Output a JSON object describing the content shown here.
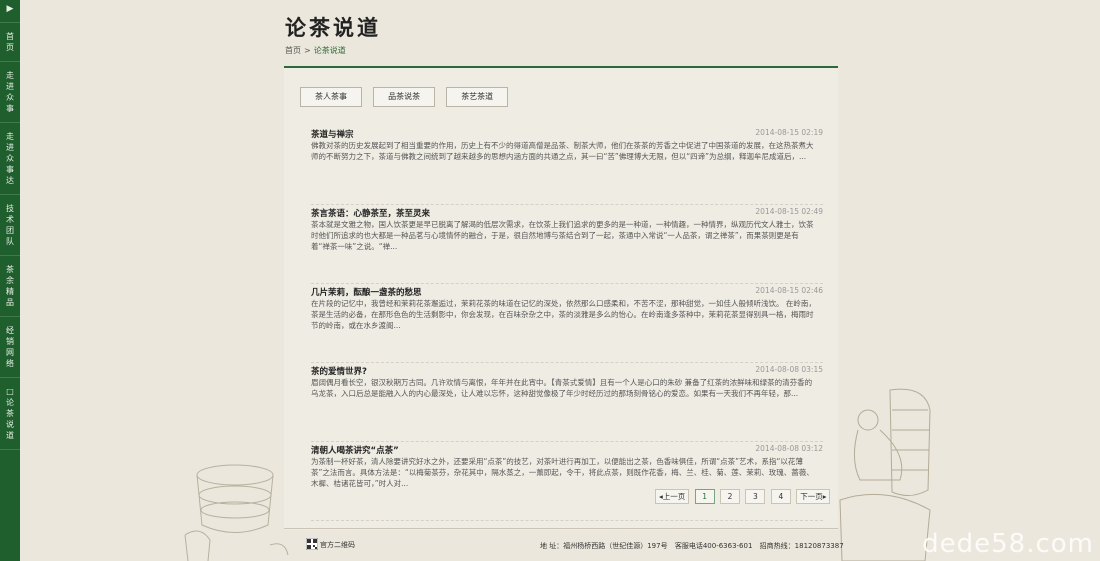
{
  "sidenav": {
    "arrow": "▶",
    "items": [
      {
        "label": "首页",
        "chars": [
          "首",
          "页"
        ]
      },
      {
        "label": "走进众事",
        "chars": [
          "走",
          "进",
          "众",
          "事"
        ]
      },
      {
        "label": "走进众事达",
        "chars": [
          "走",
          "进",
          "众",
          "事",
          "达"
        ]
      },
      {
        "label": "技术团队",
        "chars": [
          "技",
          "术",
          "团",
          "队"
        ]
      },
      {
        "label": "茶余精品",
        "chars": [
          "茶",
          "余",
          "精",
          "品"
        ]
      },
      {
        "label": "经销网络",
        "chars": [
          "经",
          "销",
          "网",
          "络"
        ]
      },
      {
        "label": "□论茶说道",
        "chars": [
          "□",
          "论",
          "茶",
          "说",
          "道"
        ]
      }
    ]
  },
  "header": {
    "title": "论茶说道",
    "breadcrumb": {
      "home": "首页",
      "sep": ">",
      "current": "论茶说道"
    }
  },
  "tabs": [
    "茶人茶事",
    "品茶说茶",
    "茶艺茶道"
  ],
  "articles": [
    {
      "title": "茶道与禅宗",
      "date": "2014-08-15 02:19",
      "excerpt": "佛教对茶的历史发展起到了相当重要的作用，历史上有不少的得道高僧是品茶、制茶大师，他们在茶茶的芳香之中促进了中国茶道的发展，在这热茶煮大师的不断努力之下，茶道与佛教之间统到了越来越多的思想内涵方面的共通之点，其一曰“苦”佛理博大无限，但以“四谛”为总纲，释迦牟尼成道后，..."
    },
    {
      "title": "茶言茶语：心静茶至，茶至灵来",
      "date": "2014-08-15 02:49",
      "excerpt": "茶本就是文雅之物，国人饮茶更是早已脱离了解渴的低层次需求，在饮茶上我们追求的更多的是一种道，一种情趣，一种情界，纵观历代文人雅士，饮茶时他们所追求的也大都是一种品茗与心境情怀的融合，于是，很自然地博与茶结合到了一起，茶通中入常说“一人品茶，谓之禅茶”，而果茶则更是有着“禅茶一味”之说。“禅..."
    },
    {
      "title": "几片茉莉，酝酿一盏茶的愁思",
      "date": "2014-08-15 02:46",
      "excerpt": "在片段的记忆中，我曾经和茉莉花茶邂逅过，茉莉花茶的味道在记忆的深处，依然那么口感柔和，不苦不涩，那种甜觉，一如佳人般倾听浅饮。    在岭南，茶是生活的必备，在那形色色的生活剩影中，你会发现，在百味杂杂之中，茶的淡雅是多么的怡心。在岭南逢多茶种中，茉莉花茶显得别具一格，梅雨时节的岭南，或在水乡渡阁..."
    },
    {
      "title": "茶的爱情世界?",
      "date": "2014-08-08 03:15",
      "excerpt": "眉阔偶月看长空，银汉秋期万古同。几许欢情与离恨，年年并在此宵中。【青茶式爱情】且有一个人是心口的朱砂 兼备了红茶的浓鲜味和绿茶的清芬香的乌龙茶，入口后总是能融入人的内心最深处，让人难以忘怀，这种甜觉像极了年少时经历过的那场刻骨铭心的爱恋。如果有一天我们不再年轻，那..."
    },
    {
      "title": "清朝人喝茶讲究“点茶”",
      "date": "2014-08-08 03:12",
      "excerpt": "为茶制一杯好茶，清人除要讲究好水之外，还要采用“点茶”的技艺，对茶叶进行再加工，以便能出之茶，色香味俱佳，所谓“点茶”艺术，系指“以花薄茶”之法而言。具体方法是：“以梅菊茶芬，杂花其中，隔水蒸之，一薰即起，令干，将此点茶，则既作花香，梅、兰、桂、菊、莲、茉莉、玫瑰、蔷薇、木樨、桔诸花皆可，”时人对..."
    }
  ],
  "pager": {
    "prev": "上一页",
    "pages": [
      "1",
      "2",
      "3",
      "4"
    ],
    "active": "1",
    "next": "下一页"
  },
  "footer": {
    "qr_label": "官方二维码",
    "address": "地 址：福州杨桥西路（世纪佳源）197号",
    "service": "客服电话400-6363-601",
    "hotline": "招商热线：18120873387"
  },
  "watermark": "dede58.com",
  "colors": {
    "brand_green": "#1f5f2e",
    "accent_green": "#2b6a38",
    "background": "#ebe7dc"
  }
}
